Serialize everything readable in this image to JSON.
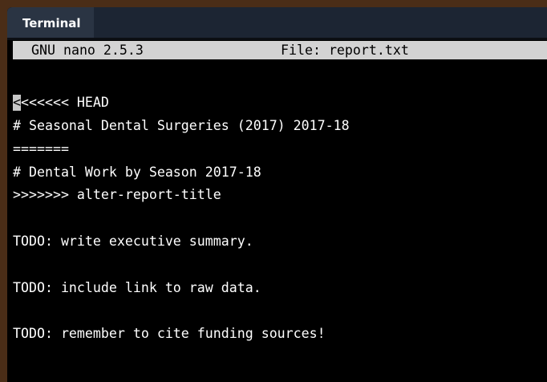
{
  "tab": {
    "title": "Terminal"
  },
  "nano": {
    "version_label": "GNU nano 2.5.3",
    "file_label": "File: report.txt"
  },
  "editor": {
    "cursor_char": "<",
    "lines": [
      "<<<<<< HEAD",
      "# Seasonal Dental Surgeries (2017) 2017-18",
      "=======",
      "# Dental Work by Season 2017-18",
      ">>>>>>> alter-report-title",
      "TODO: write executive summary.",
      "TODO: include link to raw data.",
      "TODO: remember to cite funding sources!"
    ]
  },
  "colors": {
    "background": "#000000",
    "text": "#ffffff",
    "header_bar": "#d3d3d3",
    "tab_bar": "#1c2533",
    "active_tab": "#2a3443",
    "desktop": "#4a2d17"
  }
}
